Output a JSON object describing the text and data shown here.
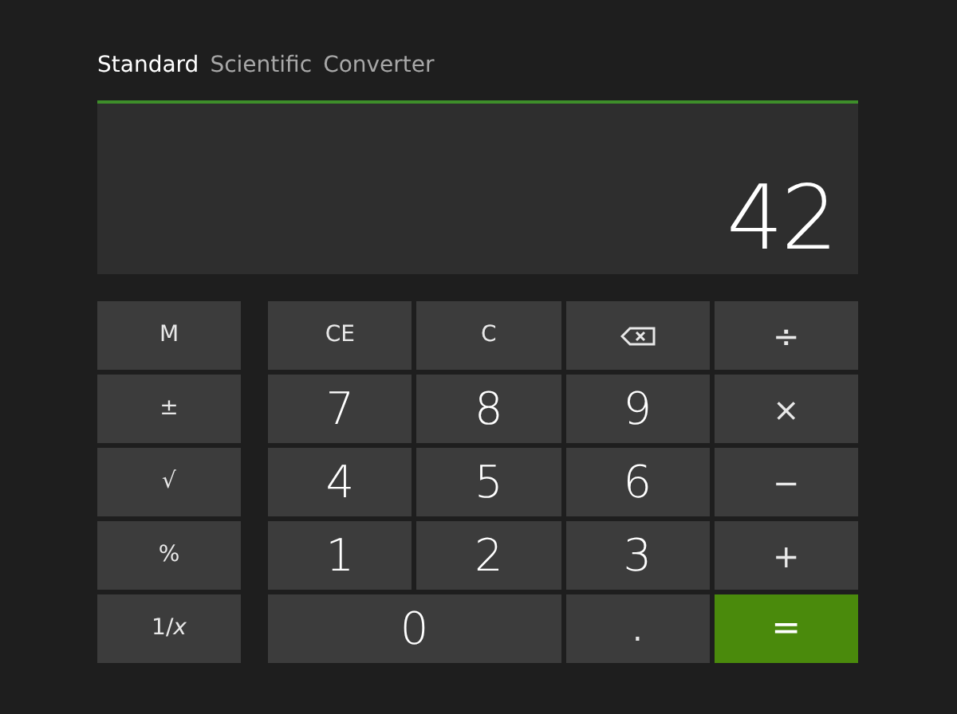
{
  "tabs": [
    {
      "label": "Standard",
      "selected": true
    },
    {
      "label": "Scientific",
      "selected": false
    },
    {
      "label": "Converter",
      "selected": false
    }
  ],
  "display": {
    "value": "42"
  },
  "side_keys": [
    {
      "label": "M"
    },
    {
      "label": "±"
    },
    {
      "label": "√"
    },
    {
      "label": "%"
    },
    {
      "label": "1/*x*"
    }
  ],
  "keys": [
    {
      "kind": "function",
      "label": "CE"
    },
    {
      "kind": "function",
      "label": "C"
    },
    {
      "kind": "backspace"
    },
    {
      "kind": "operator",
      "label": "÷"
    },
    {
      "kind": "digit",
      "label": "7"
    },
    {
      "kind": "digit",
      "label": "8"
    },
    {
      "kind": "digit",
      "label": "9"
    },
    {
      "kind": "operator",
      "label": "×"
    },
    {
      "kind": "digit",
      "label": "4"
    },
    {
      "kind": "digit",
      "label": "5"
    },
    {
      "kind": "digit",
      "label": "6"
    },
    {
      "kind": "operator",
      "label": "−"
    },
    {
      "kind": "digit",
      "label": "1"
    },
    {
      "kind": "digit",
      "label": "2"
    },
    {
      "kind": "digit",
      "label": "3"
    },
    {
      "kind": "operator",
      "label": "+"
    },
    {
      "kind": "wide-digit",
      "label": "0"
    },
    {
      "kind": "operator",
      "label": "."
    },
    {
      "kind": "equals",
      "label": "="
    }
  ]
}
